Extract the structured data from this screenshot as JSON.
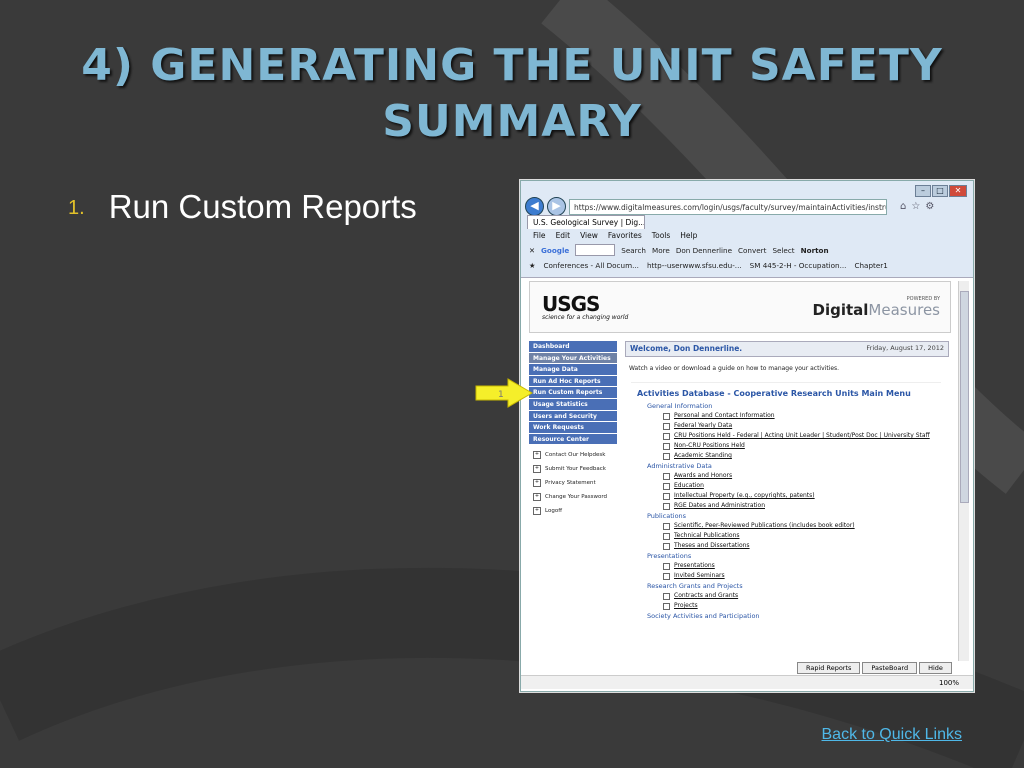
{
  "slide": {
    "title": "4) GENERATING THE UNIT SAFETY SUMMARY",
    "bullet_number": "1.",
    "bullet_text": "Run Custom Reports",
    "back_link": "Back to Quick Links",
    "arrow_label": "1"
  },
  "browser": {
    "url": "https://www.digitalmeasures.com/login/usgs/faculty/survey/maintainActivities/instrument.do?s..",
    "tab_title": "U.S. Geological Survey | Dig...",
    "menu": [
      "File",
      "Edit",
      "View",
      "Favorites",
      "Tools",
      "Help"
    ],
    "toolbar": {
      "google": "Google",
      "search": "Search",
      "more": "More",
      "user": "Don Dennerline",
      "convert": "Convert",
      "select": "Select",
      "norton": "Norton"
    },
    "favorites": [
      "Conferences - All Docum...",
      "http--userwww.sfsu.edu-...",
      "SM 445-2-H - Occupation...",
      "Chapter1"
    ],
    "zoom": "100%",
    "bottom_tabs": [
      "Rapid Reports",
      "PasteBoard",
      "Hide"
    ]
  },
  "page": {
    "logo": "USGS",
    "logo_tagline": "science for a changing world",
    "powered_by": "POWERED BY",
    "dm_brand_bold": "Digital",
    "dm_brand_light": "Measures",
    "welcome": "Welcome, Don Dennerline.",
    "date": "Friday, August 17, 2012",
    "watch": "Watch a video or download a guide on how to manage your activities.",
    "sidebar": [
      "Dashboard",
      "Manage Your Activities",
      "Manage Data",
      "Run Ad Hoc Reports",
      "Run Custom Reports",
      "Usage Statistics",
      "Users and Security",
      "Work Requests",
      "Resource Center"
    ],
    "side_links": [
      "Contact Our Helpdesk",
      "Submit Your Feedback",
      "Privacy Statement",
      "Change Your Password",
      "Logoff"
    ],
    "panel_title": "Activities Database - Cooperative Research Units Main Menu",
    "sections": [
      {
        "name": "General Information",
        "items": [
          "Personal and Contact Information",
          "Federal Yearly Data",
          "CRU Positions Held - Federal | Acting Unit Leader | Student/Post Doc | University Staff",
          "Non-CRU Positions Held",
          "Academic Standing"
        ]
      },
      {
        "name": "Administrative Data",
        "items": [
          "Awards and Honors",
          "Education",
          "Intellectual Property (e.g., copyrights, patents)",
          "RGE Dates and Administration"
        ]
      },
      {
        "name": "Publications",
        "items": [
          "Scientific, Peer-Reviewed Publications (includes book editor)",
          "Technical Publications",
          "Theses and Dissertations"
        ]
      },
      {
        "name": "Presentations",
        "items": [
          "Presentations",
          "Invited Seminars"
        ]
      },
      {
        "name": "Research Grants and Projects",
        "items": [
          "Contracts and Grants",
          "Projects"
        ]
      },
      {
        "name": "Society Activities and Participation",
        "items": []
      }
    ]
  }
}
